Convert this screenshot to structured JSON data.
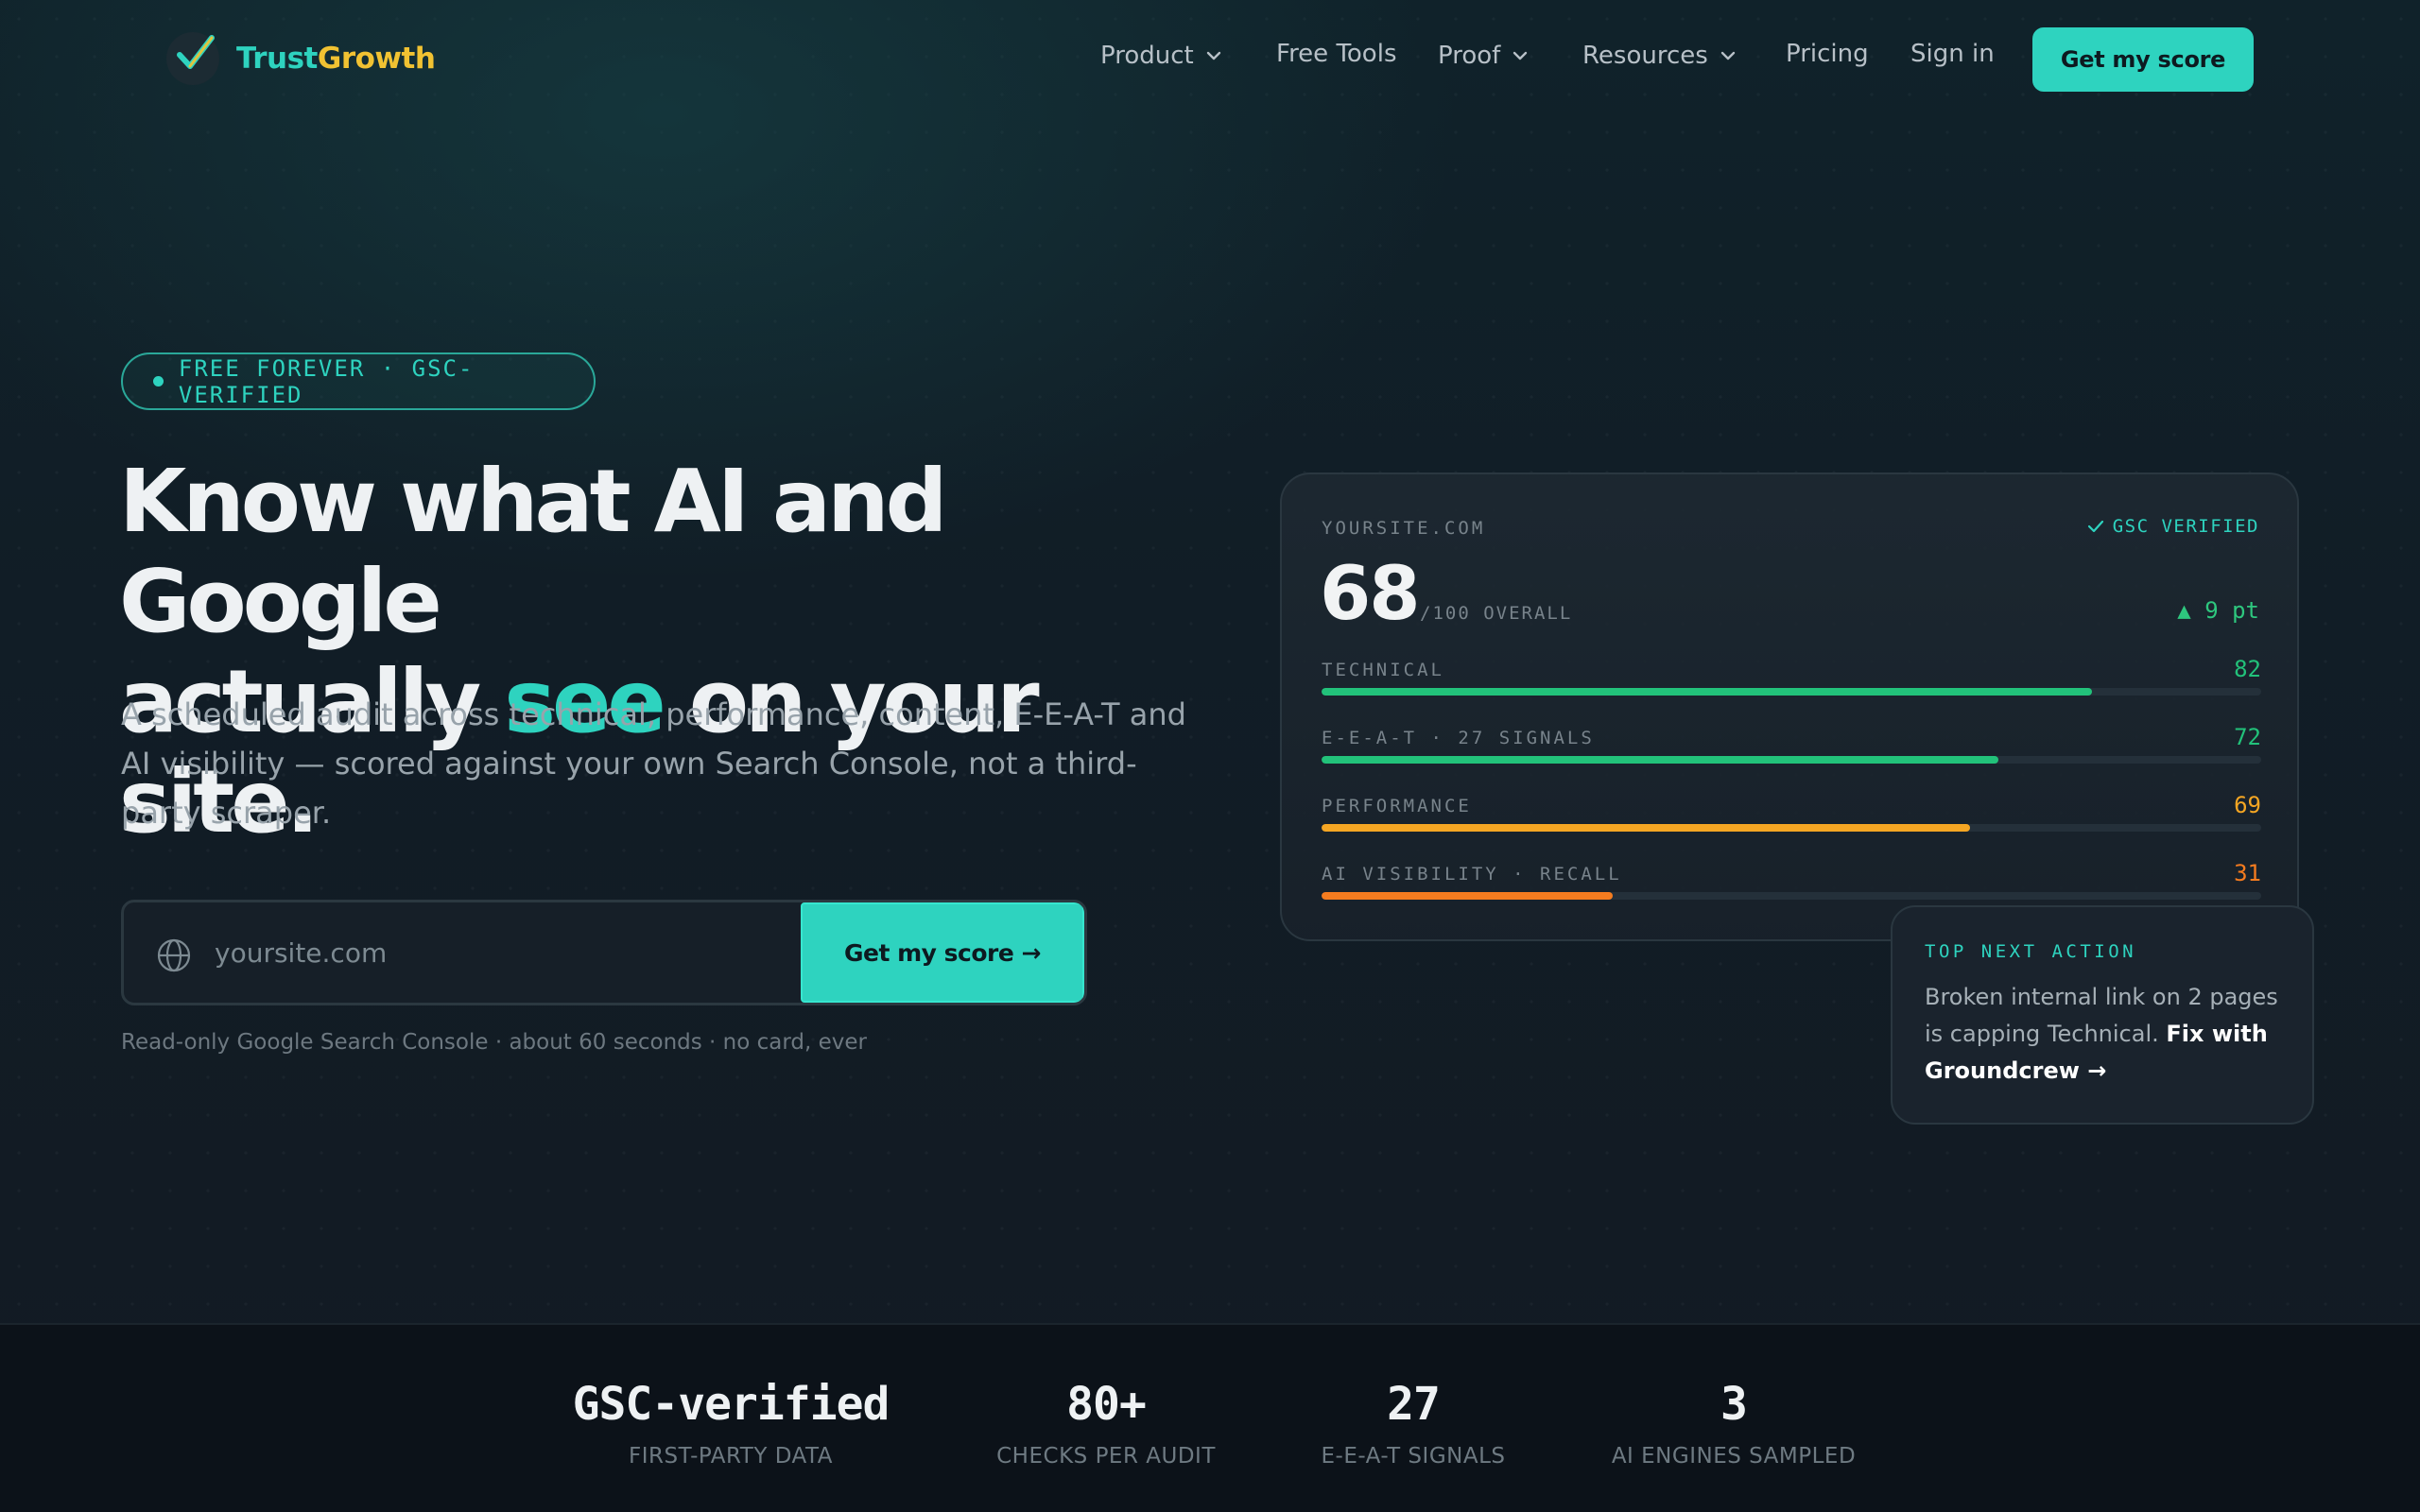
{
  "nav": {
    "brand_part1": "Trust",
    "brand_part2": "Growth",
    "items": [
      {
        "label": "Product",
        "dropdown": true
      },
      {
        "label": "Free Tools",
        "dropdown": false
      },
      {
        "label": "Proof",
        "dropdown": true
      },
      {
        "label": "Resources",
        "dropdown": true
      },
      {
        "label": "Pricing",
        "dropdown": false
      },
      {
        "label": "Sign in",
        "dropdown": false
      }
    ],
    "cta": "Get my score"
  },
  "hero": {
    "badge": "FREE FOREVER · GSC-VERIFIED",
    "headline_line1": "Know what AI and Google",
    "headline_pre": "actually ",
    "headline_accent": "see",
    "headline_post": " on your site.",
    "subtext": "A scheduled audit across technical, performance, content, E-E-A-T and AI visibility — scored against your own Search Console, not a third-party scraper.",
    "input_placeholder": "yoursite.com",
    "input_value": "",
    "submit_label": "Get my score →",
    "fineprint": "Read-only Google Search Console · about 60 seconds · no card, ever"
  },
  "score_card": {
    "site": "YOURSITE.COM",
    "verified": "GSC VERIFIED",
    "score": "68",
    "score_label": "/100 OVERALL",
    "delta": "▲ 9 pt",
    "metrics": [
      {
        "label": "TECHNICAL",
        "value": "82",
        "fill": 0.82,
        "color": "#22c27a"
      },
      {
        "label": "E-E-A-T · 27 SIGNALS",
        "value": "72",
        "fill": 0.72,
        "color": "#22c27a"
      },
      {
        "label": "PERFORMANCE",
        "value": "69",
        "fill": 0.69,
        "color": "#f5a623"
      },
      {
        "label": "AI VISIBILITY · RECALL",
        "value": "31",
        "fill": 0.31,
        "color": "#f57c1f"
      }
    ]
  },
  "next_action": {
    "label": "TOP NEXT ACTION",
    "text": "Broken internal link on 2 pages is capping Technical.",
    "link": "Fix with Groundcrew →"
  },
  "stats": [
    {
      "value": "GSC-verified",
      "label": "FIRST-PARTY DATA"
    },
    {
      "value": "80+",
      "label": "CHECKS PER AUDIT"
    },
    {
      "value": "27",
      "label": "E-E-A-T SIGNALS"
    },
    {
      "value": "3",
      "label": "AI ENGINES SAMPLED"
    }
  ],
  "colors": {
    "accent": "#2ed3bf",
    "brand_yellow": "#f1c232",
    "good": "#22c27a",
    "warn": "#f5a623",
    "bad": "#f57c1f"
  },
  "icons": {
    "logo": "checkmark-logo-icon",
    "chevron": "chevron-down-icon",
    "globe": "globe-icon",
    "check": "check-icon"
  }
}
